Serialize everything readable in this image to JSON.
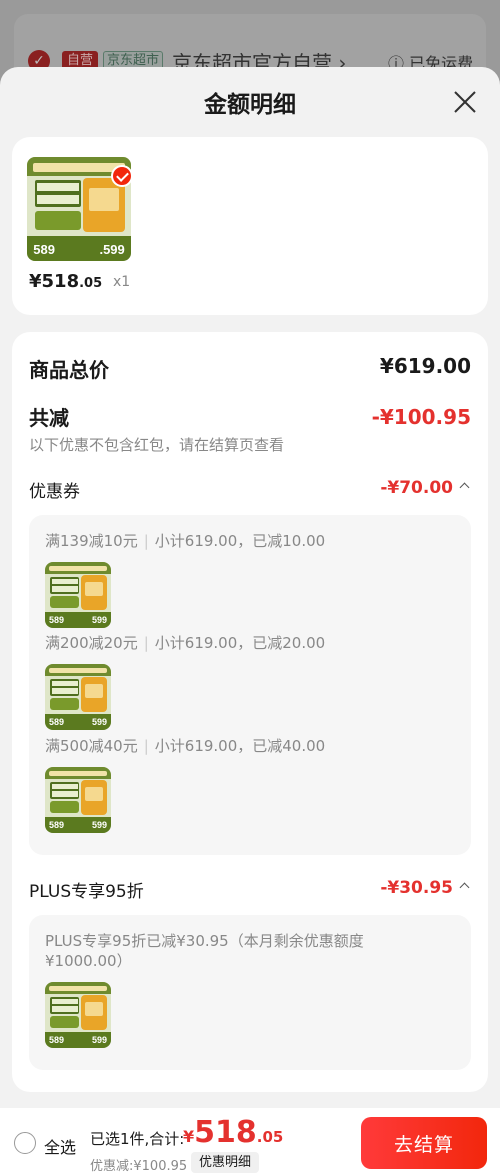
{
  "background": {
    "tag_self": "自营",
    "tag_market": "京东超市",
    "store_name": "京东超市官方自营",
    "store_chevron": "›",
    "free_shipping": "ⓘ 已免运费"
  },
  "sheet": {
    "title": "金额明细",
    "close_icon": "close-icon"
  },
  "product": {
    "price_main": "¥518",
    "price_decimal": ".05",
    "quantity": "x1",
    "thumb_left_price": "589",
    "thumb_right_price": ".599"
  },
  "detail": {
    "total_label": "商品总价",
    "total_value": "¥619.00",
    "reduce_label": "共减",
    "reduce_value": "-¥100.95",
    "reduce_note": "以下优惠不包含红包，请在结算页查看",
    "coupon_label": "优惠券",
    "coupon_value": "-¥70.00",
    "coupons": [
      {
        "rule": "满139减10元",
        "detail": "小计619.00，已减10.00",
        "thumb_l": "589",
        "thumb_r": "599"
      },
      {
        "rule": "满200减20元",
        "detail": "小计619.00，已减20.00",
        "thumb_l": "589",
        "thumb_r": "599"
      },
      {
        "rule": "满500减40元",
        "detail": "小计619.00，已减40.00",
        "thumb_l": "589",
        "thumb_r": "599"
      }
    ],
    "plus_label": "PLUS专享95折",
    "plus_value": "-¥30.95",
    "plus_note_line1": "PLUS专享95折已减¥30.95（本月剩余优惠额度",
    "plus_note_line2": "¥1000.00）",
    "plus_thumb_l": "589",
    "plus_thumb_r": "599"
  },
  "bottom": {
    "select_all": "全选",
    "summary_label": "已选1件,合计:",
    "currency": "¥",
    "total_int": "518",
    "total_dec": ".05",
    "discount_text": "优惠减:¥100.95",
    "detail_button": "优惠明细",
    "checkout_button": "去结算"
  },
  "colors": {
    "accent_red": "#e4312e",
    "checkout_red": "#f2270c"
  }
}
